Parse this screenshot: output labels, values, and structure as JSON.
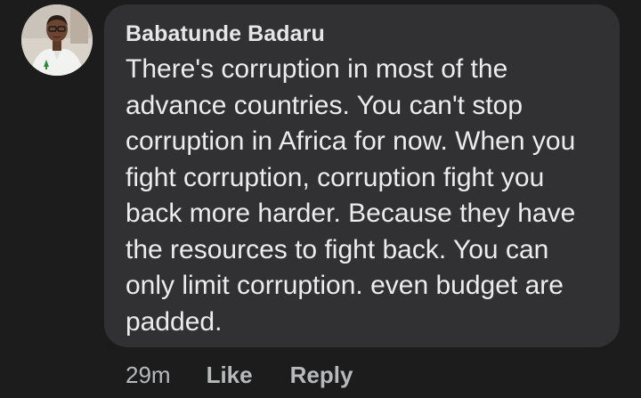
{
  "comment": {
    "author": "Babatunde Badaru",
    "text": "There's corruption in most of the advance countries. You can't stop corruption in Africa for now. When you fight corruption, corruption fight you back more harder. Because they have the resources to fight back. You can only limit corruption. even budget are padded.",
    "timestamp": "29m",
    "like_label": "Like",
    "reply_label": "Reply"
  },
  "colors": {
    "background": "#1c1c1d",
    "bubble": "#313133",
    "text": "#ececec",
    "muted": "#b8b9bb"
  },
  "icons": {
    "avatar": "profile-photo"
  }
}
